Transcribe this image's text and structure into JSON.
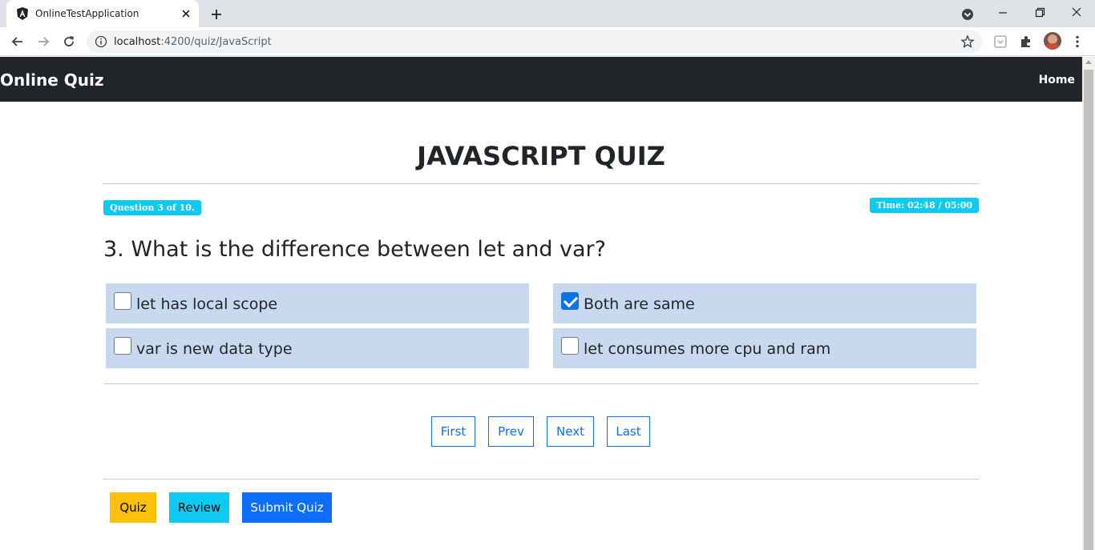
{
  "browser": {
    "tab_title": "OnlineTestApplication",
    "url_host": "localhost",
    "url_path": ":4200/quiz/JavaScript"
  },
  "navbar": {
    "brand": "Online Quiz",
    "home_link": "Home"
  },
  "quiz": {
    "title": "JAVASCRIPT QUIZ",
    "question_badge": "Question 3 of 10.",
    "timer_badge": "Time: 02:48 / 05:00",
    "question": "3. What is the difference between let and var?",
    "options": [
      {
        "label": "let has local scope",
        "checked": false
      },
      {
        "label": "Both are same",
        "checked": true
      },
      {
        "label": "var is new data type",
        "checked": false
      },
      {
        "label": "let consumes more cpu and ram",
        "checked": false
      }
    ]
  },
  "pager": {
    "first": "First",
    "prev": "Prev",
    "next": "Next",
    "last": "Last"
  },
  "actions": {
    "quiz": "Quiz",
    "review": "Review",
    "submit": "Submit Quiz"
  },
  "colors": {
    "navbar": "#212529",
    "badge": "#0dcaf0",
    "option_bg": "#c8d9ef",
    "quiz_btn": "#ffc107",
    "review_btn": "#0dcaf0",
    "submit_btn": "#0d6efd"
  }
}
